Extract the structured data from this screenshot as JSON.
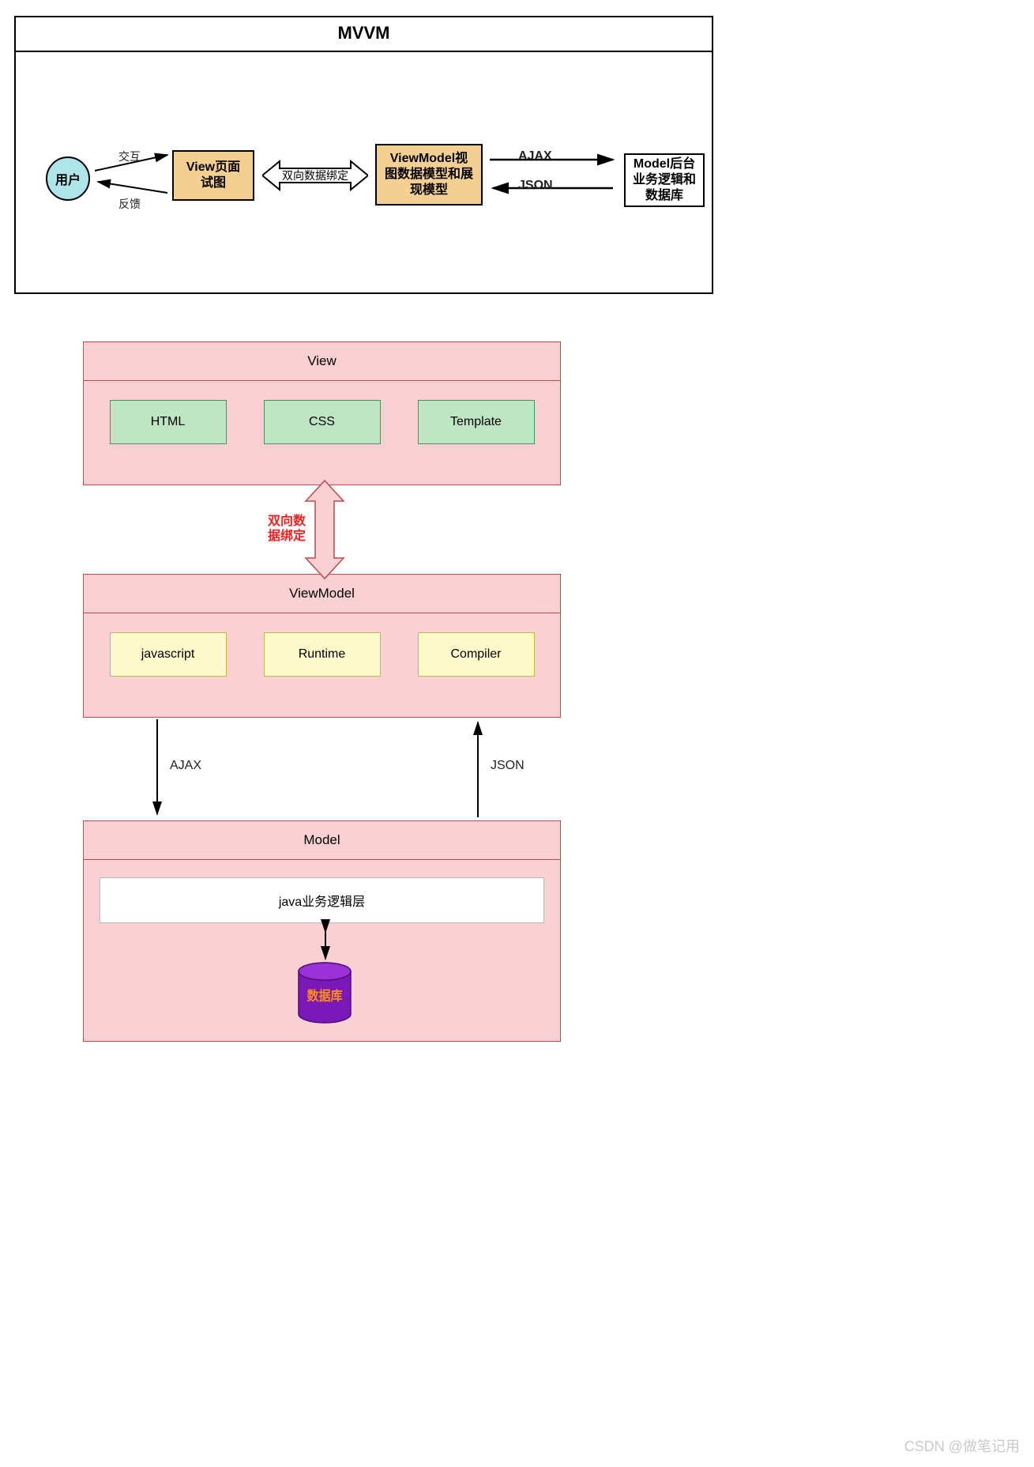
{
  "watermark": "CSDN @做笔记用",
  "top": {
    "title": "MVVM",
    "user": "用户",
    "userEdges": {
      "top": "交互",
      "bottom": "反馈"
    },
    "view": "View页面\n试图",
    "binding": "双向数据绑定",
    "viewModel": "ViewModel视\n图数据模型和展\n现模型",
    "ajax": "AJAX",
    "json": "JSON",
    "model": "Model后台\n业务逻辑和\n数据库"
  },
  "bottom": {
    "view": {
      "title": "View",
      "cells": [
        "HTML",
        "CSS",
        "Template"
      ]
    },
    "bindingLabel": "双向数\n据绑定",
    "viewModel": {
      "title": "ViewModel",
      "cells": [
        "javascript",
        "Runtime",
        "Compiler"
      ]
    },
    "ajax": "AJAX",
    "json": "JSON",
    "model": {
      "title": "Model",
      "row": "java业务逻辑层",
      "db": "数据库"
    }
  }
}
